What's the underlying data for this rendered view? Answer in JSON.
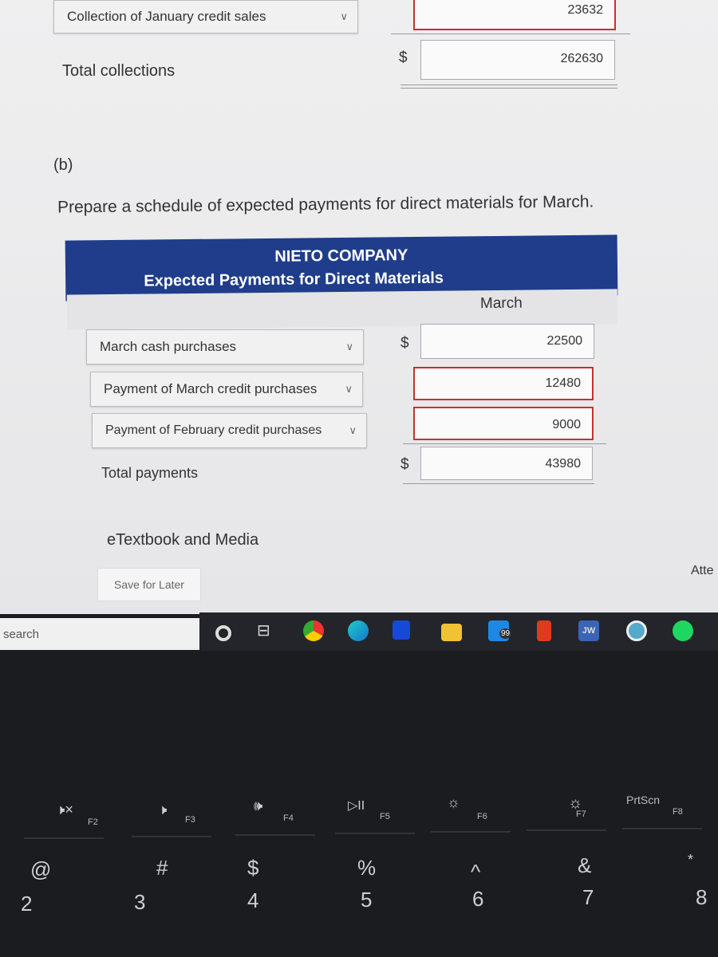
{
  "top_rows": {
    "collection_jan_label": "Collection of January credit sales",
    "collection_jan_value": "23632",
    "total_collections_label": "Total collections",
    "total_collections_currency": "$",
    "total_collections_value": "262630"
  },
  "part_label": "(b)",
  "instruction": "Prepare a schedule of expected payments for direct materials for March.",
  "schedule": {
    "company": "NIETO COMPANY",
    "title": "Expected Payments for Direct Materials",
    "column": "March",
    "rows": [
      {
        "label": "March cash purchases",
        "currency": "$",
        "value": "22500",
        "error": false
      },
      {
        "label": "Payment of March credit purchases",
        "currency": "",
        "value": "12480",
        "error": true
      },
      {
        "label": "Payment of February credit purchases",
        "currency": "",
        "value": "9000",
        "error": true
      }
    ],
    "total_label": "Total payments",
    "total_currency": "$",
    "total_value": "43980"
  },
  "etextbook_label": "eTextbook and Media",
  "save_for_later": "Save for Later",
  "attempts_partial": "Atte",
  "taskbar": {
    "search_placeholder": "search",
    "mail_badge": "99",
    "jw_label": "JW",
    "icons": [
      "cortana-icon",
      "task-view-icon",
      "chrome-icon",
      "edge-icon",
      "app-icon",
      "file-explorer-icon",
      "mail-icon",
      "office-icon",
      "jw-library-icon",
      "app-circle-icon",
      "spotify-icon"
    ]
  },
  "keyboard": {
    "fn_keys": [
      "F2",
      "F3",
      "F4",
      "F5",
      "F6",
      "F7",
      "F8"
    ],
    "prtscn": "PrtScn",
    "number_keys": [
      {
        "top": "@",
        "bottom": "2"
      },
      {
        "top": "#",
        "bottom": "3"
      },
      {
        "top": "$",
        "bottom": "4"
      },
      {
        "top": "%",
        "bottom": "5"
      },
      {
        "top": "^",
        "bottom": "6"
      },
      {
        "top": "&",
        "bottom": "7"
      },
      {
        "top": "*",
        "bottom": "8"
      }
    ]
  },
  "colors": {
    "header_bg": "#1f3d8a",
    "error_border": "#c9302c",
    "taskbar": "#23252a"
  }
}
